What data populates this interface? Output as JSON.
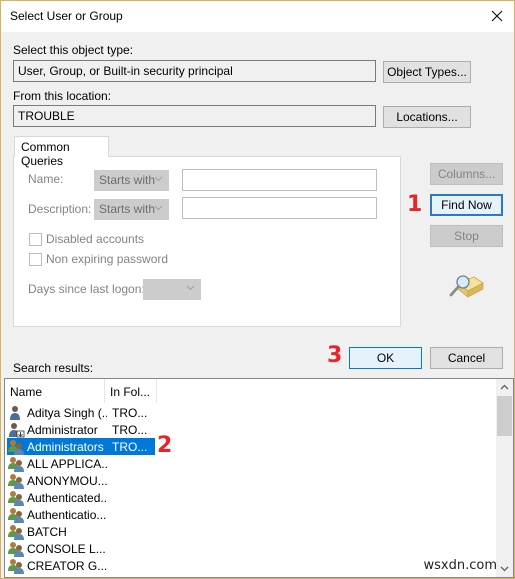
{
  "window": {
    "title": "Select User or Group",
    "close_icon": "close-icon"
  },
  "object_type": {
    "label": "Select this object type:",
    "value": "User, Group, or Built-in security principal",
    "button": "Object Types..."
  },
  "location": {
    "label": "From this location:",
    "value": "TROUBLE",
    "button": "Locations..."
  },
  "common_queries": {
    "tab_label": "Common Queries",
    "name_label": "Name:",
    "name_match": "Starts with",
    "name_value": "",
    "description_label": "Description:",
    "description_match": "Starts with",
    "description_value": "",
    "disabled_accounts_label": "Disabled accounts",
    "disabled_accounts_checked": false,
    "non_expiring_label": "Non expiring password",
    "non_expiring_checked": false,
    "days_label": "Days since last logon:",
    "days_value": ""
  },
  "side_buttons": {
    "columns": "Columns...",
    "find_now": "Find Now",
    "stop": "Stop",
    "search_icon": "search-folder-icon"
  },
  "annotations": {
    "step1": "1",
    "step2": "2",
    "step3": "3"
  },
  "dialog_buttons": {
    "ok": "OK",
    "cancel": "Cancel"
  },
  "results": {
    "label": "Search results:",
    "columns": [
      "Name",
      "In Fol..."
    ],
    "rows": [
      {
        "name": "Aditya Singh (...",
        "folder": "TRO...",
        "icon": "user-icon",
        "selected": false
      },
      {
        "name": "Administrator",
        "folder": "TRO...",
        "icon": "user-admin-icon",
        "selected": false
      },
      {
        "name": "Administrators",
        "folder": "TRO...",
        "icon": "group-icon",
        "selected": true
      },
      {
        "name": "ALL APPLICA...",
        "folder": "",
        "icon": "group-icon",
        "selected": false
      },
      {
        "name": "ANONYMOU...",
        "folder": "",
        "icon": "group-icon",
        "selected": false
      },
      {
        "name": "Authenticated...",
        "folder": "",
        "icon": "group-icon",
        "selected": false
      },
      {
        "name": "Authenticatio...",
        "folder": "",
        "icon": "group-icon",
        "selected": false
      },
      {
        "name": "BATCH",
        "folder": "",
        "icon": "group-icon",
        "selected": false
      },
      {
        "name": "CONSOLE L...",
        "folder": "",
        "icon": "group-icon",
        "selected": false
      },
      {
        "name": "CREATOR G...",
        "folder": "",
        "icon": "group-icon",
        "selected": false
      }
    ]
  },
  "watermark": "wsxdn.com",
  "colors": {
    "accent": "#0078d7",
    "annotation": "#e8242b",
    "window_border": "#d9b35a"
  }
}
